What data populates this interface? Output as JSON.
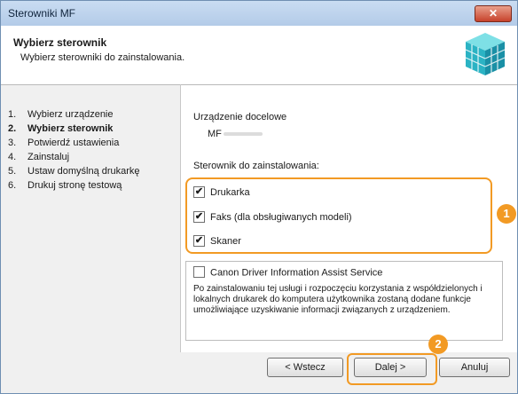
{
  "window": {
    "title": "Sterowniki MF",
    "close_label": "✕"
  },
  "header": {
    "title": "Wybierz sterownik",
    "subtitle": "Wybierz sterowniki do zainstalowania."
  },
  "steps": [
    {
      "num": "1.",
      "label": "Wybierz urządzenie",
      "active": false
    },
    {
      "num": "2.",
      "label": "Wybierz sterownik",
      "active": true
    },
    {
      "num": "3.",
      "label": "Potwierdź ustawienia",
      "active": false
    },
    {
      "num": "4.",
      "label": "Zainstaluj",
      "active": false
    },
    {
      "num": "5.",
      "label": "Ustaw domyślną drukarkę",
      "active": false
    },
    {
      "num": "6.",
      "label": "Drukuj stronę testową",
      "active": false
    }
  ],
  "content": {
    "target_device_label": "Urządzenie docelowe",
    "target_device_value": "MF",
    "drivers_label": "Sterownik do zainstalowania:",
    "drivers": [
      {
        "label": "Drukarka",
        "checked": true
      },
      {
        "label": "Faks (dla obsługiwanych modeli)",
        "checked": true
      },
      {
        "label": "Skaner",
        "checked": true
      }
    ],
    "assist": {
      "label": "Canon Driver Information Assist Service",
      "checked": false,
      "description": "Po zainstalowaniu tej usługi i rozpoczęciu korzystania z współdzielonych i lokalnych drukarek do komputera użytkownika zostaną dodane funkcje umożliwiające uzyskiwanie informacji związanych z urządzeniem."
    }
  },
  "buttons": {
    "back": "< Wstecz",
    "next": "Dalej >",
    "cancel": "Anuluj"
  },
  "callouts": {
    "one": "1",
    "two": "2"
  },
  "colors": {
    "accent": "#f29a24",
    "titlebar": "#c9dcf2"
  },
  "icons": {
    "header_icon": "driver-package-cube-icon",
    "checkbox_mark": "✔"
  }
}
